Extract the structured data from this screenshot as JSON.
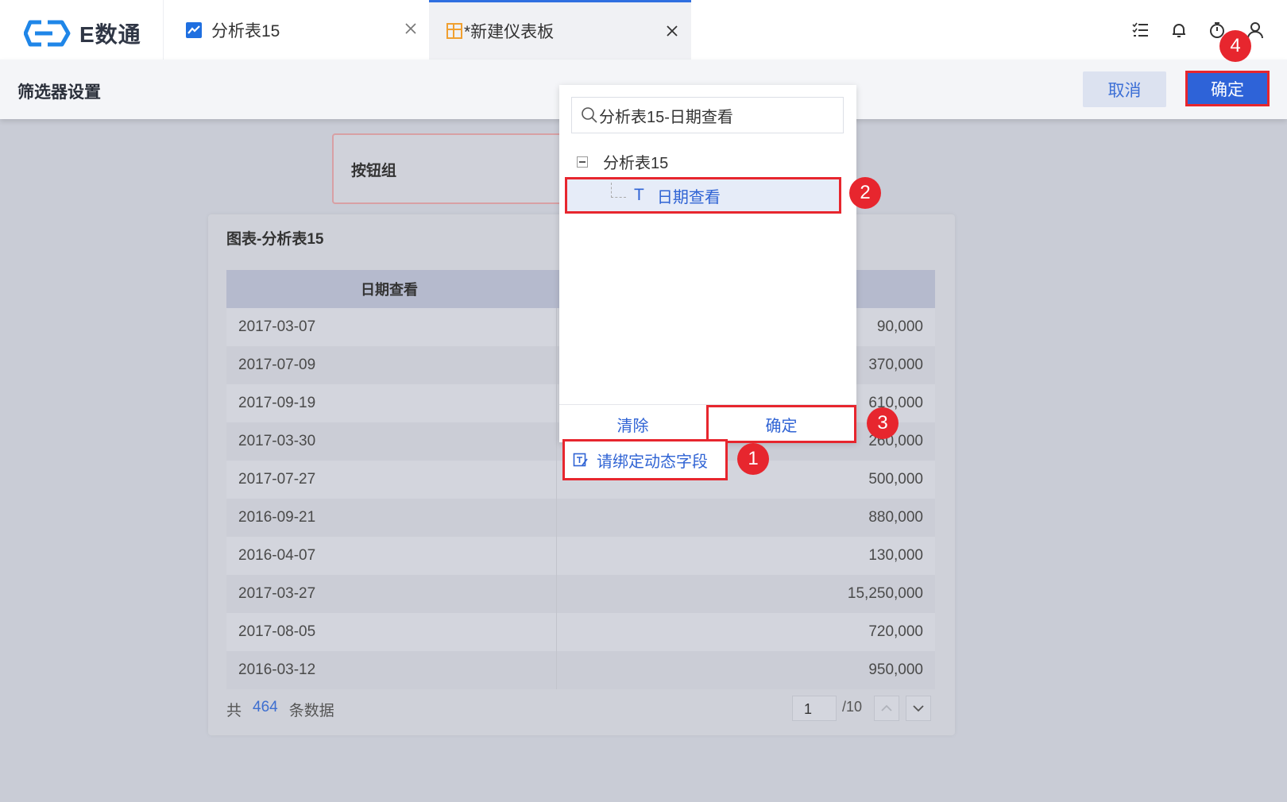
{
  "app": {
    "logo_text": "E数通"
  },
  "tabs": [
    {
      "label": "分析表15",
      "icon": "line-chart-icon"
    },
    {
      "label": "*新建仪表板",
      "icon": "dashboard-icon"
    }
  ],
  "top_icons": [
    "task-list-icon",
    "bell-icon",
    "timer-icon",
    "user-icon"
  ],
  "settings": {
    "title": "筛选器设置",
    "cancel_label": "取消",
    "ok_label": "确定"
  },
  "canvas": {
    "button_group_label": "按钮组",
    "chart_title": "图表-分析表15",
    "table": {
      "date_header": "日期查看",
      "rows": [
        {
          "date": "2017-03-07",
          "value": "90,000"
        },
        {
          "date": "2017-07-09",
          "value": "370,000"
        },
        {
          "date": "2017-09-19",
          "value": "610,000"
        },
        {
          "date": "2017-03-30",
          "value": "260,000"
        },
        {
          "date": "2017-07-27",
          "value": "500,000"
        },
        {
          "date": "2016-09-21",
          "value": "880,000"
        },
        {
          "date": "2016-04-07",
          "value": "130,000"
        },
        {
          "date": "2017-03-27",
          "value": "15,250,000"
        },
        {
          "date": "2017-08-05",
          "value": "720,000"
        },
        {
          "date": "2016-03-12",
          "value": "950,000"
        }
      ]
    },
    "footer": {
      "prefix": "共",
      "count": "464",
      "suffix": "条数据",
      "page": "1",
      "total_pages": "/10"
    }
  },
  "dropdown": {
    "search_value": "分析表15-日期查看",
    "tree_root": "分析表15",
    "tree_child_type": "T",
    "tree_child": "日期查看",
    "clear_label": "清除",
    "ok_label": "确定"
  },
  "bind_button": {
    "label": "请绑定动态字段"
  },
  "markers": [
    "1",
    "2",
    "3",
    "4"
  ],
  "colors": {
    "accent": "#2e63d8",
    "highlight": "#e7262e"
  }
}
